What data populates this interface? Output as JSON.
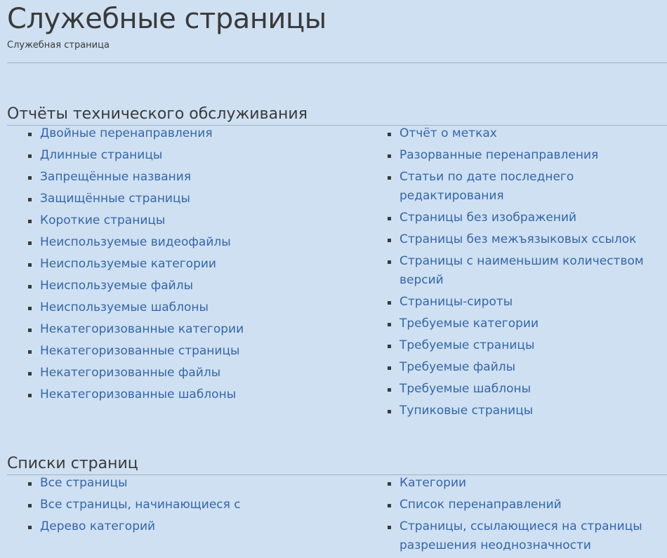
{
  "header": {
    "title": "Служебные страницы",
    "subtitle": "Служебная страница"
  },
  "sections": [
    {
      "heading": "Отчёты технического обслуживания",
      "left": [
        "Двойные перенаправления",
        "Длинные страницы",
        "Запрещённые названия",
        "Защищённые страницы",
        "Короткие страницы",
        "Неиспользуемые видеофайлы",
        "Неиспользуемые категории",
        "Неиспользуемые файлы",
        "Неиспользуемые шаблоны",
        "Некатегоризованные категории",
        "Некатегоризованные страницы",
        "Некатегоризованные файлы",
        "Некатегоризованные шаблоны"
      ],
      "right": [
        "Отчёт о метках",
        "Разорванные перенаправления",
        "Статьи по дате последнего редактирования",
        "Страницы без изображений",
        "Страницы без межъязыковых ссылок",
        "Страницы с наименьшим количеством версий",
        "Страницы-сироты",
        "Требуемые категории",
        "Требуемые страницы",
        "Требуемые файлы",
        "Требуемые шаблоны",
        "Тупиковые страницы"
      ]
    },
    {
      "heading": "Списки страниц",
      "left": [
        "Все страницы",
        "Все страницы, начинающиеся с",
        "Дерево категорий"
      ],
      "right": [
        "Категории",
        "Список перенаправлений",
        "Страницы, ссылающиеся на страницы разрешения неоднозначности"
      ]
    }
  ]
}
